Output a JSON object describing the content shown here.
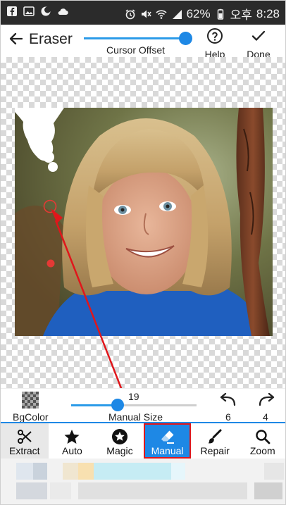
{
  "status_bar": {
    "battery_percent": "62%",
    "ampm": "오후",
    "time": "8:28",
    "icons": [
      "facebook-icon",
      "image-icon",
      "cloud-icon",
      "alarm-icon",
      "mute-icon",
      "wifi-icon",
      "signal-icon",
      "battery-icon"
    ]
  },
  "header": {
    "title": "Eraser",
    "cursor_offset_label": "Cursor Offset",
    "cursor_offset_value": 1.0,
    "help_label": "Help",
    "done_label": "Done"
  },
  "size_row": {
    "bgcolor_label": "BgColor",
    "manual_size_value": "19",
    "manual_size_label": "Manual Size",
    "undo_count": "6",
    "redo_count": "4"
  },
  "tools": [
    {
      "label": "Extract",
      "icon": "scissors-icon",
      "state": "pressed"
    },
    {
      "label": "Auto",
      "icon": "star-icon",
      "state": "normal"
    },
    {
      "label": "Magic",
      "icon": "magic-star-icon",
      "state": "normal"
    },
    {
      "label": "Manual",
      "icon": "eraser-icon",
      "state": "active"
    },
    {
      "label": "Repair",
      "icon": "brush-icon",
      "state": "normal"
    },
    {
      "label": "Zoom",
      "icon": "zoom-icon",
      "state": "normal"
    }
  ],
  "colors": {
    "accent": "#1e88e5",
    "highlight": "#e0161b",
    "statusbar": "#2b2b2b"
  }
}
